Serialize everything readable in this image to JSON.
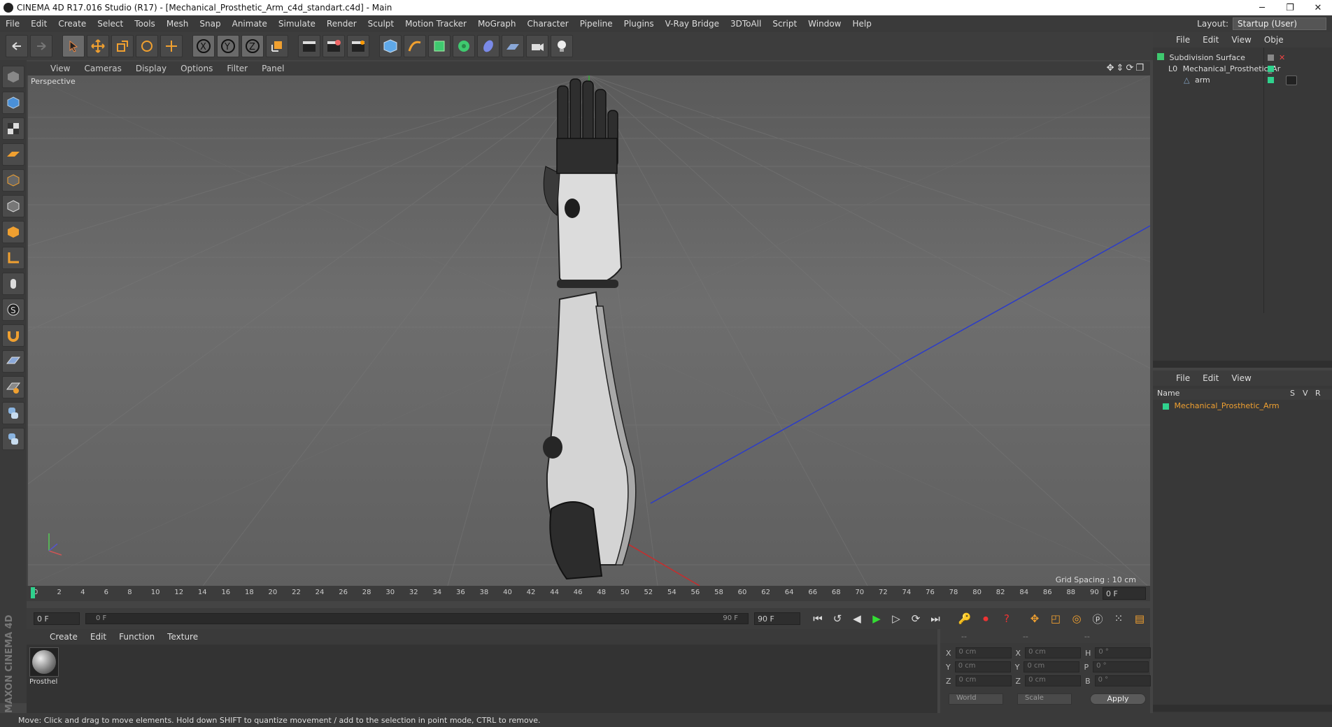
{
  "window": {
    "title": "CINEMA 4D R17.016 Studio (R17) - [Mechanical_Prosthetic_Arm_c4d_standart.c4d] - Main"
  },
  "menu": [
    "File",
    "Edit",
    "Create",
    "Select",
    "Tools",
    "Mesh",
    "Snap",
    "Animate",
    "Simulate",
    "Render",
    "Sculpt",
    "Motion Tracker",
    "MoGraph",
    "Character",
    "Pipeline",
    "Plugins",
    "V-Ray Bridge",
    "3DToAll",
    "Script",
    "Window",
    "Help"
  ],
  "layout": {
    "label": "Layout:",
    "value": "Startup (User)"
  },
  "viewport": {
    "menu": [
      "View",
      "Cameras",
      "Display",
      "Options",
      "Filter",
      "Panel"
    ],
    "label": "Perspective",
    "grid_spacing": "Grid Spacing : 10 cm"
  },
  "timeline": {
    "ticks": [
      "0",
      "2",
      "4",
      "6",
      "8",
      "10",
      "12",
      "14",
      "16",
      "18",
      "20",
      "22",
      "24",
      "26",
      "28",
      "30",
      "32",
      "34",
      "36",
      "38",
      "40",
      "42",
      "44",
      "46",
      "48",
      "50",
      "52",
      "54",
      "56",
      "58",
      "60",
      "62",
      "64",
      "66",
      "68",
      "70",
      "72",
      "74",
      "76",
      "78",
      "80",
      "82",
      "84",
      "86",
      "88",
      "90"
    ],
    "frame_field": "0 F"
  },
  "playback": {
    "start": "0 F",
    "range_start": "0 F",
    "range_end": "90 F",
    "end": "90 F"
  },
  "materials": {
    "menu": [
      "Create",
      "Edit",
      "Function",
      "Texture"
    ],
    "items": [
      {
        "label": "Prosthel"
      }
    ]
  },
  "coords": {
    "headers": [
      "--",
      "--",
      "--"
    ],
    "rows": [
      {
        "a": "X",
        "v1": "0 cm",
        "b": "X",
        "v2": "0 cm",
        "c": "H",
        "v3": "0 °"
      },
      {
        "a": "Y",
        "v1": "0 cm",
        "b": "Y",
        "v2": "0 cm",
        "c": "P",
        "v3": "0 °"
      },
      {
        "a": "Z",
        "v1": "0 cm",
        "b": "Z",
        "v2": "0 cm",
        "c": "B",
        "v3": "0 °"
      }
    ],
    "world": "World",
    "scale": "Scale",
    "apply": "Apply"
  },
  "objects": {
    "menu": [
      "File",
      "Edit",
      "View",
      "Obje"
    ],
    "items": [
      "Subdivision Surface",
      "Mechanical_Prosthetic_Ar",
      "arm"
    ]
  },
  "layers": {
    "menu": [
      "File",
      "Edit",
      "View"
    ],
    "col_name": "Name",
    "cols": [
      "S",
      "V",
      "R"
    ],
    "item": "Mechanical_Prosthetic_Arm"
  },
  "status": "Move: Click and drag to move elements. Hold down SHIFT to quantize movement / add to the selection in point mode, CTRL to remove.",
  "brand": "MAXON CINEMA 4D",
  "colors": {
    "accent": "#2fd18d",
    "layer_text": "#f0a030"
  }
}
